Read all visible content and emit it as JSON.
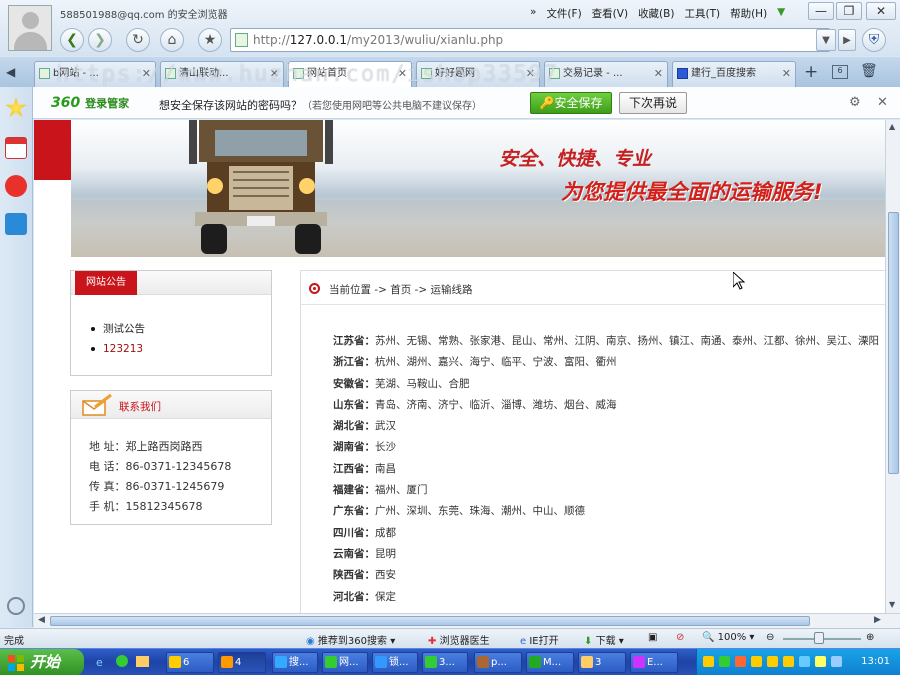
{
  "window": {
    "title": "588501988@qq.com 的安全浏览器",
    "menu": [
      "文件(F)",
      "查看(V)",
      "收藏(B)",
      "工具(T)",
      "帮助(H)"
    ],
    "controls": [
      "—",
      "❐",
      "✕"
    ]
  },
  "address": {
    "host": "127.0.0.1",
    "path": "/my2013/wuliu/xianlu.php",
    "prefix": "http://"
  },
  "tabs": [
    {
      "label": "b网站 - ...",
      "active": false
    },
    {
      "label": "清山联动...",
      "active": false
    },
    {
      "label": "网站首页",
      "active": true
    },
    {
      "label": "好好题网",
      "active": false
    },
    {
      "label": "交易记录 - ...",
      "active": false
    },
    {
      "label": "建行_百度搜索",
      "active": false
    }
  ],
  "watermark": "https://www.huzhan.com/ishop33597",
  "password_bar": {
    "logo": "360",
    "logo_sub": "登录管家",
    "prompt": "想安全保存该网站的密码吗？",
    "hint": "（若您使用网吧等公共电脑不建议保存）",
    "save_label": "安全保存",
    "later_label": "下次再说"
  },
  "banner": {
    "slogan1": "安全、快捷、专业",
    "slogan2": "为您提供最全面的运输服务!"
  },
  "notice": {
    "title": "网站公告",
    "items": [
      "测试公告",
      "123213"
    ]
  },
  "contact": {
    "title": "联系我们",
    "lines": [
      "地 址：郑上路西岗路西",
      "电 话：86-0371-12345678",
      "传 真：86-0371-1245679",
      "手 机：15812345678"
    ]
  },
  "breadcrumb": {
    "label": "当前位置",
    "path": "-> 首页 -> 运输线路"
  },
  "routes": [
    {
      "province": "江苏省：",
      "cities": "苏州、无锡、常熟、张家港、昆山、常州、江阴、南京、扬州、镇江、南通、泰州、江都、徐州、吴江、溧阳"
    },
    {
      "province": "浙江省：",
      "cities": "杭州、湖州、嘉兴、海宁、临平、宁波、富阳、衢州"
    },
    {
      "province": "安徽省：",
      "cities": "芜湖、马鞍山、合肥"
    },
    {
      "province": "山东省：",
      "cities": "青岛、济南、济宁、临沂、淄博、潍坊、烟台、威海"
    },
    {
      "province": "湖北省：",
      "cities": "武汉"
    },
    {
      "province": "湖南省：",
      "cities": "长沙"
    },
    {
      "province": "江西省：",
      "cities": "南昌"
    },
    {
      "province": "福建省：",
      "cities": "福州、厦门"
    },
    {
      "province": "广东省：",
      "cities": "广州、深圳、东莞、珠海、潮州、中山、顺德"
    },
    {
      "province": "四川省：",
      "cities": "成都"
    },
    {
      "province": "云南省：",
      "cities": "昆明"
    },
    {
      "province": "陕西省：",
      "cities": "西安"
    },
    {
      "province": "河北省：",
      "cities": "保定"
    }
  ],
  "statusbar": {
    "status": "完成",
    "search": "推荐到360搜索",
    "doctor": "浏览器医生",
    "ie": "IE打开",
    "download": "下载",
    "zoom": "100%"
  },
  "taskbar": {
    "start": "开始",
    "items": [
      "6",
      "4",
      "搜...",
      "网...",
      "锁...",
      "3...",
      "p...",
      "M...",
      "3",
      "E..."
    ],
    "clock": "13:01"
  },
  "colors": {
    "brand_red": "#c8141a",
    "save_green": "#3e9e1a",
    "taskbar_blue": "#2751b8"
  }
}
